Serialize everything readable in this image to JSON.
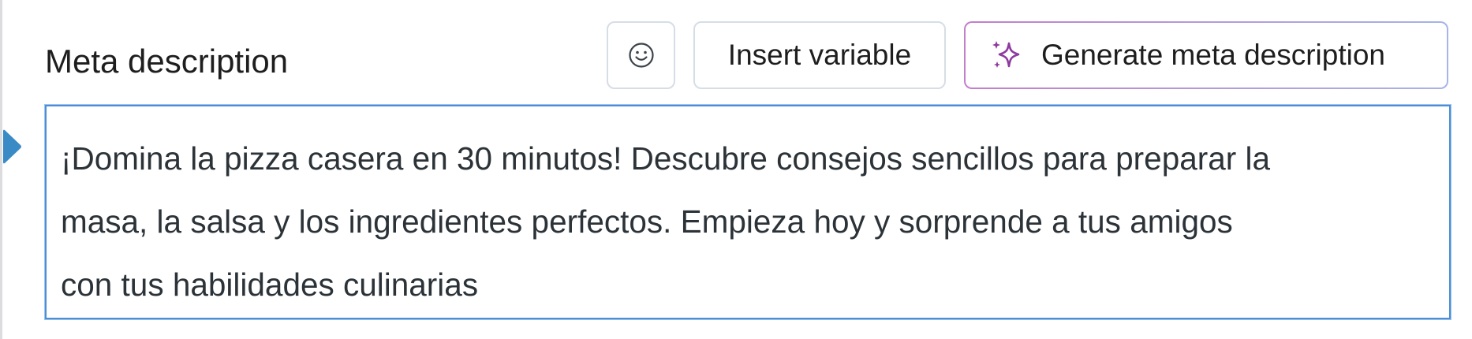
{
  "field": {
    "label": "Meta description",
    "value_lines": [
      "¡Domina la pizza casera en 30 minutos! Descubre consejos sencillos para preparar la",
      "masa, la salsa y los ingredientes perfectos. Empieza hoy y sorprende a tus amigos",
      "con tus habilidades culinarias"
    ]
  },
  "toolbar": {
    "emoji_icon": "smiley-face-icon",
    "insert_variable_label": "Insert variable",
    "generate_label": "Generate meta description",
    "generate_icon": "sparkles-icon"
  },
  "colors": {
    "focus_border": "#4b8fd6",
    "marker": "#3a8ac6",
    "ai_gradient_start": "#c27fcb",
    "ai_gradient_end": "#a7b3ea",
    "sparkle": "#9b3fa8"
  }
}
